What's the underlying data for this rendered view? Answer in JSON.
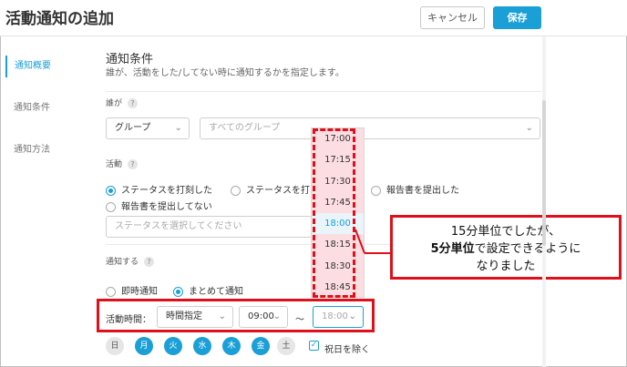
{
  "header": {
    "title": "活動通知の追加",
    "cancel_label": "キャンセル",
    "save_label": "保存"
  },
  "sidebar": {
    "items": [
      {
        "label": "通知概要"
      },
      {
        "label": "通知条件"
      },
      {
        "label": "通知方法"
      }
    ]
  },
  "section": {
    "title": "通知条件",
    "description": "誰が、活動をした/してない時に通知するかを指定します。"
  },
  "who": {
    "label": "誰が",
    "help": "?",
    "type_value": "グループ",
    "group_placeholder": "すべてのグループ"
  },
  "activity": {
    "label": "活動",
    "help": "?",
    "options": [
      {
        "label": "ステータスを打刻した",
        "selected": true
      },
      {
        "label": "ステータスを打",
        "selected": false
      },
      {
        "label": "報告書を提出した",
        "selected": false
      },
      {
        "label": "報告書を提出してない",
        "selected": false
      }
    ],
    "status_placeholder": "ステータスを選択してください"
  },
  "notify": {
    "label": "通知する",
    "help": "?",
    "options": [
      {
        "label": "即時通知",
        "selected": false
      },
      {
        "label": "まとめて通知",
        "selected": true
      }
    ]
  },
  "activity_time": {
    "label": "活動時間：",
    "mode_value": "時間指定",
    "from_value": "09:00",
    "separator": "〜",
    "to_value": "18:00"
  },
  "time_dropdown": {
    "options": [
      "17:00",
      "17:15",
      "17:30",
      "17:45",
      "18:00",
      "18:15",
      "18:30",
      "18:45"
    ],
    "selected": "18:00"
  },
  "days": [
    {
      "label": "日",
      "on": false
    },
    {
      "label": "月",
      "on": true
    },
    {
      "label": "火",
      "on": true
    },
    {
      "label": "水",
      "on": true
    },
    {
      "label": "木",
      "on": true
    },
    {
      "label": "金",
      "on": true
    },
    {
      "label": "土",
      "on": false
    }
  ],
  "holiday": {
    "label": "祝日を除く",
    "checked": true
  },
  "callout": {
    "line1": "15分単位でしたが、",
    "line2_bold": "5分単位",
    "line2_rest": "で設定できるように",
    "line3": "なりました"
  },
  "colors": {
    "accent": "#1a9fd6",
    "annotation": "#e0101a",
    "dropdown_highlight": "#fbdde2"
  }
}
